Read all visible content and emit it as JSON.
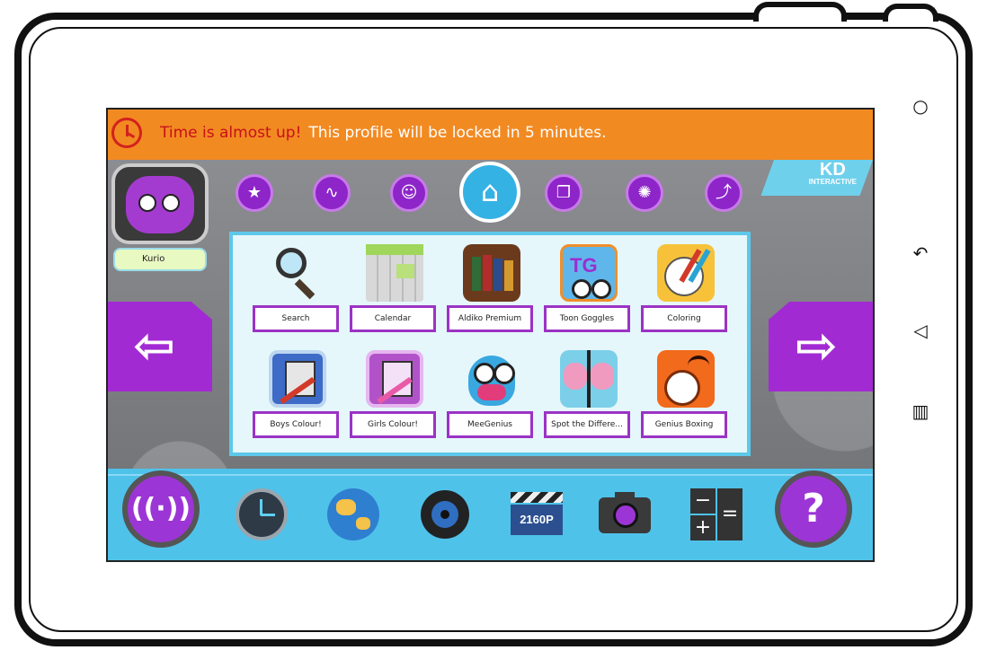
{
  "banner": {
    "warning": "Time is almost up!",
    "message": "This profile will be locked in 5 minutes."
  },
  "brand": {
    "logo_text": "KD",
    "logo_sub": "INTERACTIVE"
  },
  "profile": {
    "name": "Kurio"
  },
  "top_nav": [
    {
      "icon": "star-icon"
    },
    {
      "icon": "wave-icon"
    },
    {
      "icon": "smiley-icon"
    },
    {
      "icon": "home-icon"
    },
    {
      "icon": "squares-icon"
    },
    {
      "icon": "splash-icon"
    },
    {
      "icon": "path-icon"
    }
  ],
  "apps": [
    {
      "label": "Search"
    },
    {
      "label": "Calendar"
    },
    {
      "label": "Aldiko Premium"
    },
    {
      "label": "Toon Goggles"
    },
    {
      "label": "Coloring"
    },
    {
      "label": "Boys Colour!"
    },
    {
      "label": "Girls Colour!"
    },
    {
      "label": "MeeGenius"
    },
    {
      "label": "Spot the Differe..."
    },
    {
      "label": "Genius Boxing"
    }
  ],
  "dock": {
    "video_badge": "2160P"
  },
  "colors": {
    "banner": "#f28a22",
    "accent_purple": "#9c35d6",
    "accent_blue": "#4fc2ea"
  }
}
